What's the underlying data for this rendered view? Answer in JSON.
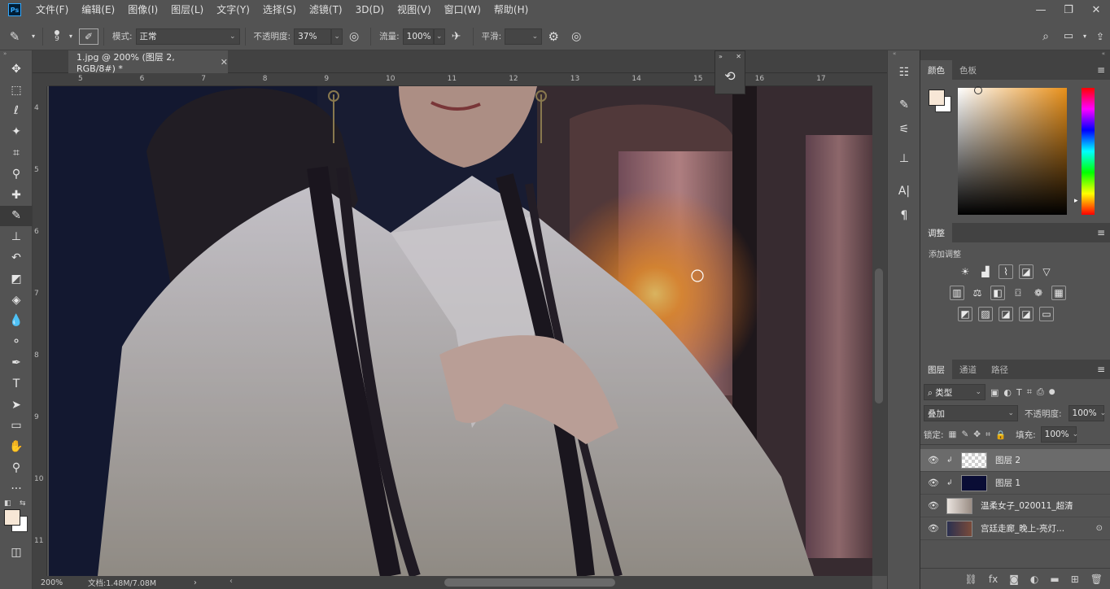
{
  "menubar": {
    "app_icon": "Ps",
    "items": [
      "文件(F)",
      "编辑(E)",
      "图像(I)",
      "图层(L)",
      "文字(Y)",
      "选择(S)",
      "滤镜(T)",
      "3D(D)",
      "视图(V)",
      "窗口(W)",
      "帮助(H)"
    ],
    "window_controls": [
      "minimize-icon",
      "restore-icon",
      "close-icon"
    ]
  },
  "options": {
    "brush_size": "9",
    "mode_label": "模式:",
    "mode_value": "正常",
    "opacity_label": "不透明度:",
    "opacity_value": "37%",
    "flow_label": "流量:",
    "flow_value": "100%",
    "smoothing_label": "平滑:",
    "smoothing_value": ""
  },
  "document": {
    "tab_title": "1.jpg @ 200% (图层 2, RGB/8#) *",
    "zoom": "200%",
    "doc_size": "文档:1.48M/7.08M",
    "hruler": [
      "5",
      "6",
      "7",
      "8",
      "9",
      "10",
      "11",
      "12",
      "13",
      "14",
      "15",
      "16",
      "17"
    ],
    "vruler": [
      "4",
      "5",
      "6",
      "7",
      "8",
      "9",
      "10",
      "11"
    ]
  },
  "color_panel": {
    "tabs": [
      "颜色",
      "色板"
    ],
    "foreground": "#f7e7d6",
    "background": "#ffffff",
    "hue_color": "#e8901a"
  },
  "adjustments_panel": {
    "tab": "调整",
    "subtitle": "添加调整"
  },
  "layers_panel": {
    "tabs": [
      "图层",
      "通道",
      "路径"
    ],
    "filter_label": "类型",
    "blend_mode": "叠加",
    "opacity_label": "不透明度:",
    "opacity_value": "100%",
    "lock_label": "锁定:",
    "fill_label": "填充:",
    "fill_value": "100%",
    "layers": [
      {
        "name": "图层 2",
        "selected": true
      },
      {
        "name": "图层 1",
        "selected": false
      },
      {
        "name": "温柔女子_020011_超清",
        "selected": false
      },
      {
        "name": "宫廷走廊_晚上-亮灯...",
        "selected": false
      }
    ]
  }
}
